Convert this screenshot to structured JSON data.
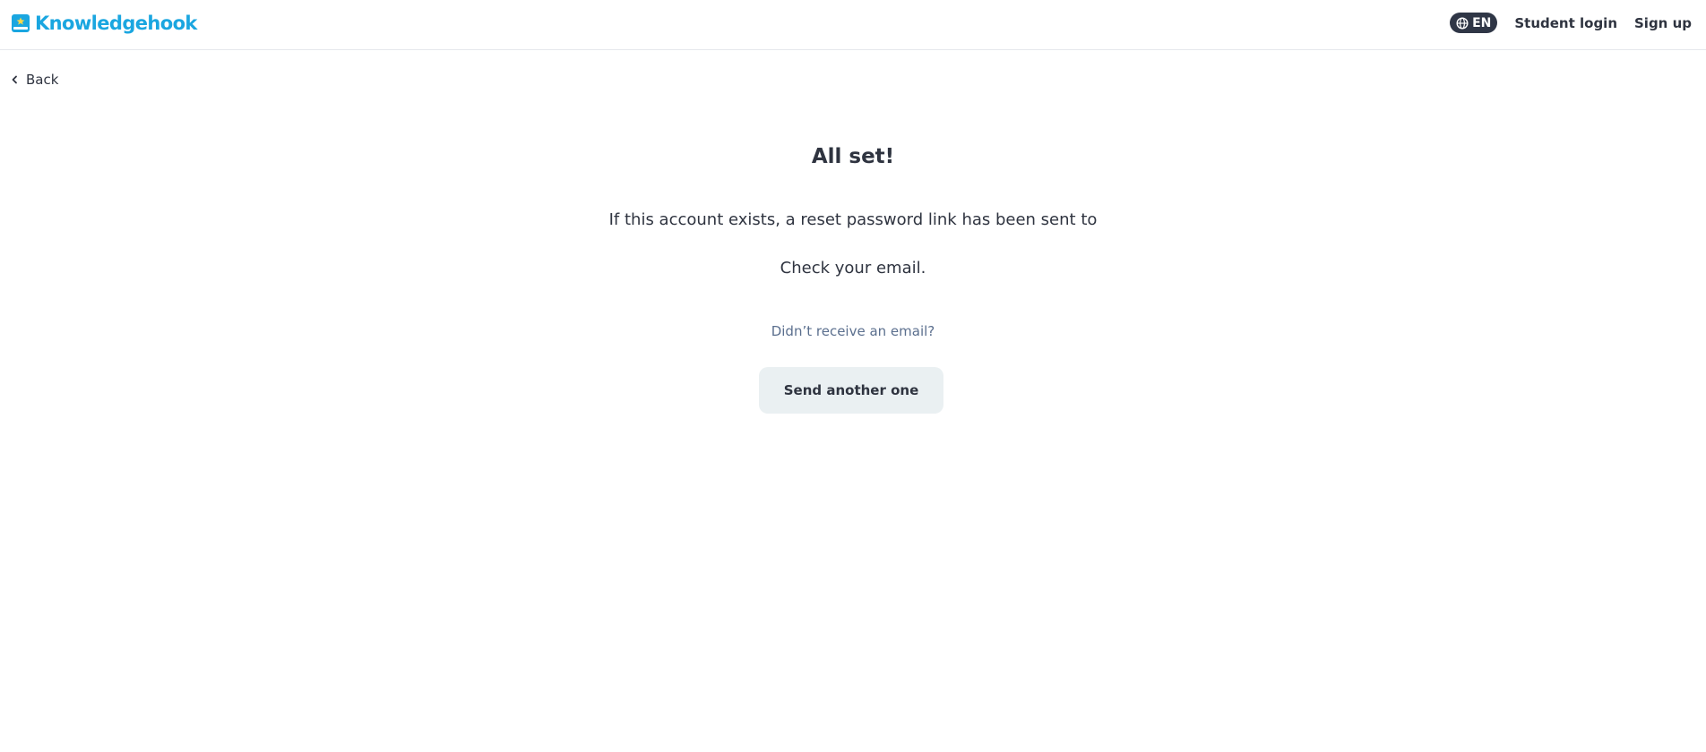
{
  "header": {
    "brand": "Knowledgehook",
    "language": "EN",
    "student_login": "Student login",
    "sign_up": "Sign up"
  },
  "nav": {
    "back_label": "Back"
  },
  "main": {
    "title": "All set!",
    "message": "If this account exists, a reset password link has been sent to",
    "instruction": "Check your email.",
    "hint": "Didn’t receive an email?",
    "resend_label": "Send another one"
  },
  "colors": {
    "brand": "#1aa6e0",
    "text": "#2f3440",
    "muted_link": "#5b6f8e",
    "button_bg": "#eaf0f2",
    "pill_bg": "#2f3646"
  },
  "icons": {
    "logo": "book-star-icon",
    "language": "globe-icon",
    "back": "chevron-left-icon"
  }
}
